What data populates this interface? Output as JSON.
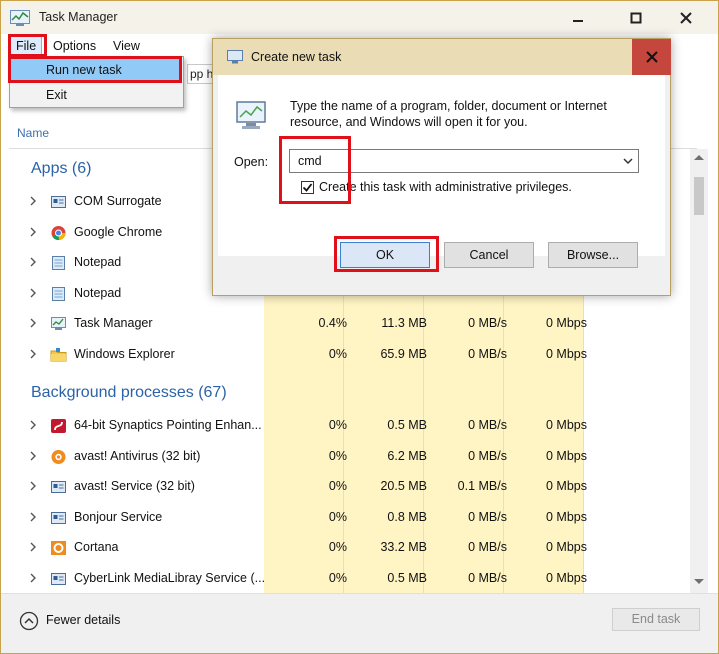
{
  "window": {
    "title": "Task Manager"
  },
  "menu": {
    "file": "File",
    "options": "Options",
    "view": "View"
  },
  "file_menu": {
    "run_new_task": "Run new task",
    "exit": "Exit"
  },
  "tab_peek": "pp hi",
  "columns": {
    "name": "Name"
  },
  "groups": {
    "apps": "Apps (6)",
    "background": "Background processes (67)"
  },
  "apps": [
    {
      "name": "COM Surrogate",
      "icon": "com-surrogate-icon",
      "cpu": "",
      "mem": "",
      "disk": "",
      "net": ""
    },
    {
      "name": "Google Chrome",
      "icon": "chrome-icon",
      "cpu": "",
      "mem": "",
      "disk": "",
      "net": ""
    },
    {
      "name": "Notepad",
      "icon": "notepad-icon",
      "cpu": "",
      "mem": "",
      "disk": "",
      "net": ""
    },
    {
      "name": "Notepad",
      "icon": "notepad-icon",
      "cpu": "",
      "mem": "",
      "disk": "",
      "net": ""
    },
    {
      "name": "Task Manager",
      "icon": "task-manager-icon",
      "cpu": "0.4%",
      "mem": "11.3 MB",
      "disk": "0 MB/s",
      "net": "0 Mbps"
    },
    {
      "name": "Windows Explorer",
      "icon": "folder-icon",
      "cpu": "0%",
      "mem": "65.9 MB",
      "disk": "0 MB/s",
      "net": "0 Mbps"
    }
  ],
  "background": [
    {
      "name": "64-bit Synaptics Pointing Enhan...",
      "icon": "synaptics-icon",
      "cpu": "0%",
      "mem": "0.5 MB",
      "disk": "0 MB/s",
      "net": "0 Mbps"
    },
    {
      "name": "avast! Antivirus (32 bit)",
      "icon": "avast-icon",
      "cpu": "0%",
      "mem": "6.2 MB",
      "disk": "0 MB/s",
      "net": "0 Mbps"
    },
    {
      "name": "avast! Service (32 bit)",
      "icon": "service-icon",
      "cpu": "0%",
      "mem": "20.5 MB",
      "disk": "0.1 MB/s",
      "net": "0 Mbps"
    },
    {
      "name": "Bonjour Service",
      "icon": "service-icon",
      "cpu": "0%",
      "mem": "0.8 MB",
      "disk": "0 MB/s",
      "net": "0 Mbps"
    },
    {
      "name": "Cortana",
      "icon": "cortana-icon",
      "cpu": "0%",
      "mem": "33.2 MB",
      "disk": "0 MB/s",
      "net": "0 Mbps"
    },
    {
      "name": "CyberLink MediaLibray Service (...",
      "icon": "service-icon",
      "cpu": "0%",
      "mem": "0.5 MB",
      "disk": "0 MB/s",
      "net": "0 Mbps"
    }
  ],
  "footer": {
    "fewer_details": "Fewer details",
    "end_task": "End task"
  },
  "dialog": {
    "title": "Create new task",
    "desc_line1": "Type the name of a program, folder, document or Internet",
    "desc_line2": "resource, and Windows will open it for you.",
    "open_label": "Open:",
    "open_value": "cmd",
    "admin_label": "Create this task with administrative privileges.",
    "admin_checked": true,
    "ok": "OK",
    "cancel": "Cancel",
    "browse": "Browse..."
  },
  "colors": {
    "highlight": "#e0101a",
    "data_band": "#fff4c4",
    "group_header": "#2b62a8"
  }
}
